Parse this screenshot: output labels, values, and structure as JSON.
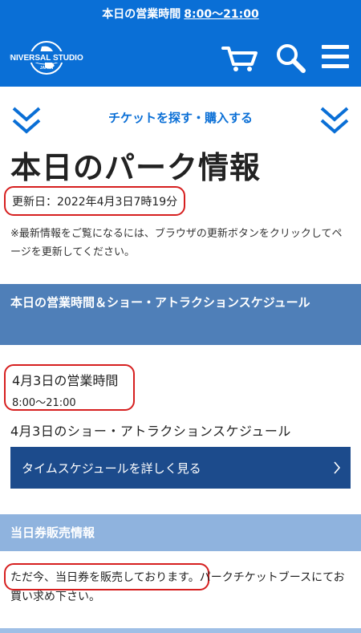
{
  "topbar": {
    "label": "本日の営業時間",
    "hours": "8:00〜21:00"
  },
  "header": {
    "logo_text_top": "UNIVERSAL STUDIOS",
    "logo_text_bottom": "JAPAN",
    "icons": [
      "cart-icon",
      "search-icon",
      "menu-icon"
    ]
  },
  "ticket_bar": {
    "link_label": "チケットを探す・購入する"
  },
  "page": {
    "title": "本日のパーク情報",
    "updated": "更新日：2022年4月3日7時19分",
    "note": "※最新情報をご覧になるには、ブラウザの更新ボタンをクリックしてページを更新してください。"
  },
  "schedule_section": {
    "heading": "本日の営業時間＆ショー・アトラクションスケジュール",
    "hours_title": "4月3日の営業時間",
    "hours_value": "8:00〜21:00",
    "show_title": "4月3日のショー・アトラクションスケジュール",
    "detail_button": "タイムスケジュールを詳しく見る"
  },
  "sale_section": {
    "heading": "当日券販売情報",
    "status_highlight": "ただ今、当日券を販売しております。",
    "status_rest": "パークチケットブースにてお買い求め下さい。"
  },
  "colors": {
    "brand_blue": "#0a6fd6",
    "section_dark": "#4f7fb8",
    "section_light": "#8fb3de",
    "button_navy": "#1c4b8c",
    "highlight_red": "#d61f1f"
  }
}
